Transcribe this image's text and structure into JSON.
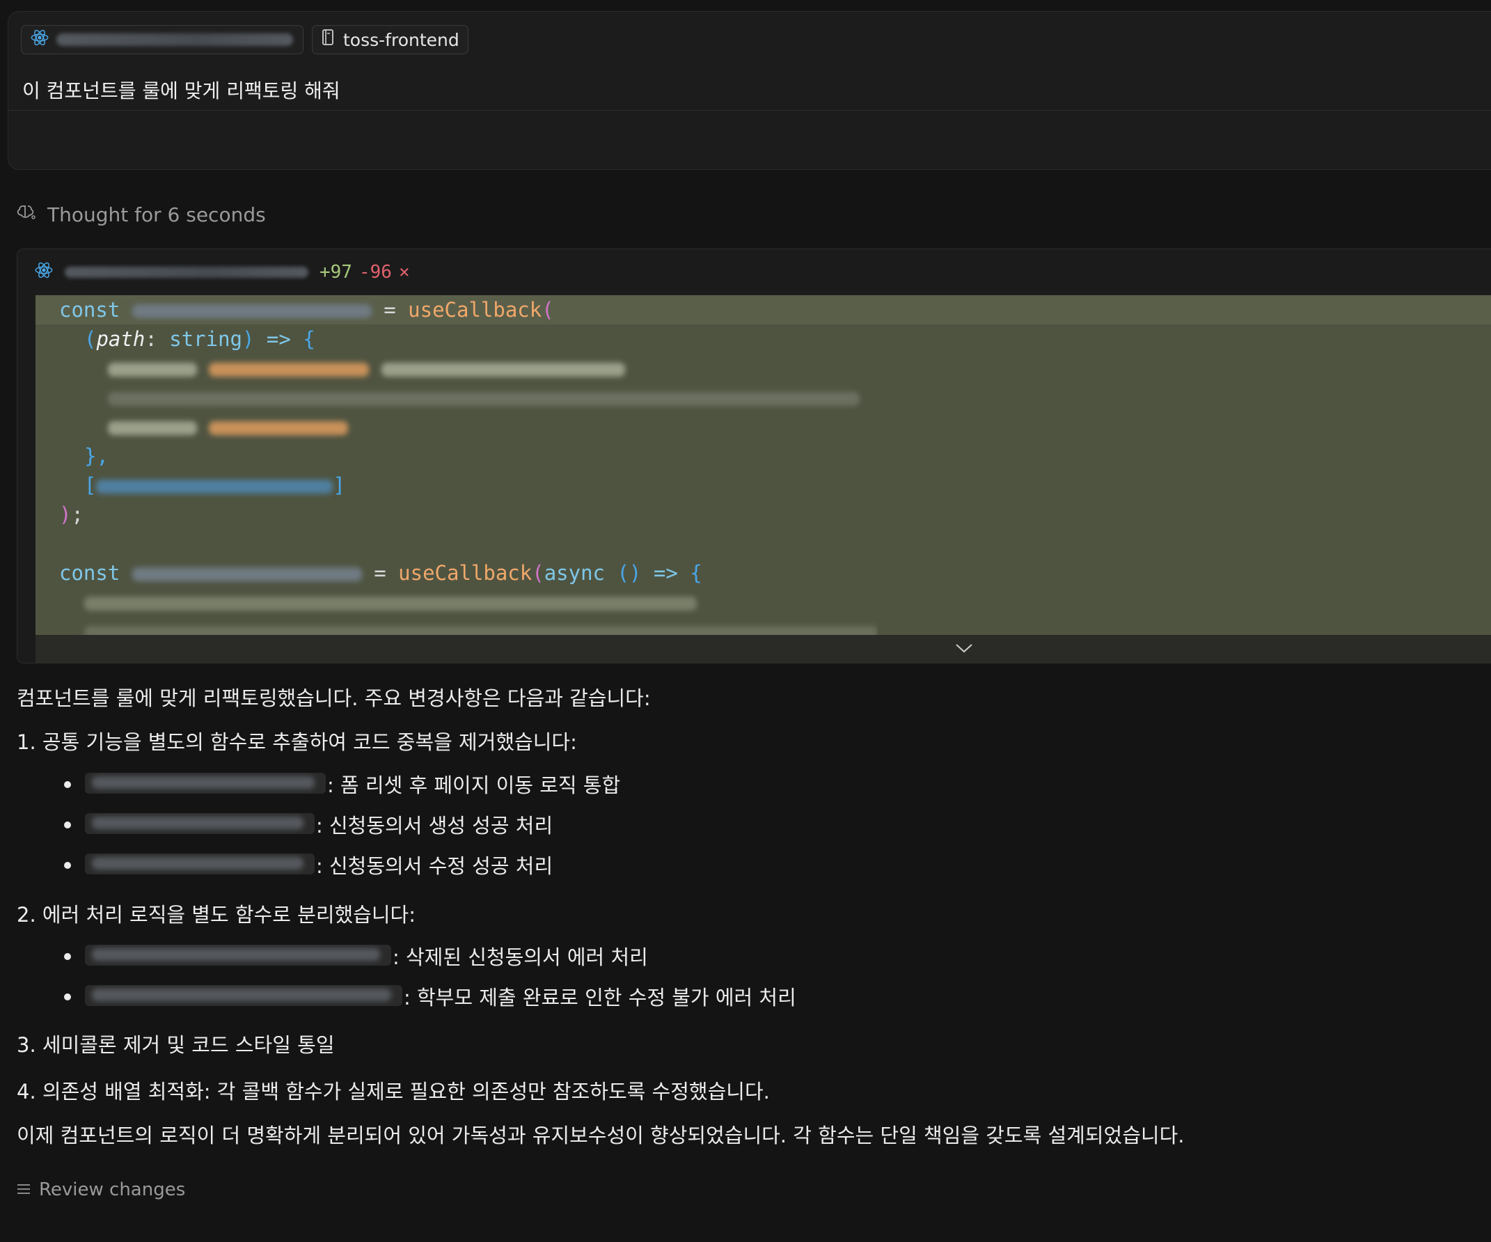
{
  "prompt": {
    "repo_chip_label": "toss-frontend",
    "text": "이 컴포넌트를 룰에 맞게 리팩토링 해줘"
  },
  "thought": {
    "label": "Thought for 6 seconds"
  },
  "diff": {
    "additions": "+97",
    "deletions": "-96",
    "close_glyph": "×",
    "code": {
      "l1_const": "const",
      "l1_eq": " = ",
      "l1_fn": "useCallback",
      "l1_open": "(",
      "l2_open": "(",
      "l2_param": "path",
      "l2_colon": ": ",
      "l2_type": "string",
      "l2_close": ")",
      "l2_arrow": " => ",
      "l2_brace": "{",
      "l6_close": "},",
      "l7_open": "[",
      "l7_close": "]",
      "l8_close": ")",
      "l8_semi": ";",
      "l10_const": "const",
      "l10_eq": " = ",
      "l10_fn": "useCallback",
      "l10_open": "(",
      "l10_async": "async",
      "l10_parens": " ()",
      "l10_arrow": " => ",
      "l10_brace": "{"
    }
  },
  "response": {
    "intro": "컴포넌트를 룰에 맞게 리팩토링했습니다. 주요 변경사항은 다음과 같습니다:",
    "item1": "1. 공통 기능을 별도의 함수로 추출하여 코드 중복을 제거했습니다:",
    "item1_b1": ": 폼 리셋 후 페이지 이동 로직 통합",
    "item1_b2": ": 신청동의서 생성 성공 처리",
    "item1_b3": ": 신청동의서 수정 성공 처리",
    "item2": "2. 에러 처리 로직을 별도 함수로 분리했습니다:",
    "item2_b1": ": 삭제된 신청동의서 에러 처리",
    "item2_b2": ": 학부모 제출 완료로 인한 수정 불가 에러 처리",
    "item3": "3. 세미콜론 제거 및 코드 스타일 통일",
    "item4": "4. 의존성 배열 최적화: 각 콜백 함수가 실제로 필요한 의존성만 참조하도록 수정했습니다.",
    "conclusion": "이제 컴포넌트의 로직이 더 명확하게 분리되어 있어 가독성과 유지보수성이 향상되었습니다. 각 함수는 단일 책임을 갖도록 설계되었습니다."
  },
  "review": {
    "label": "Review changes"
  },
  "colors": {
    "background": "#141414",
    "code_highlight": "#4f5441",
    "additions": "#a6c97a",
    "deletions": "#e0616b",
    "react_icon": "#4aa7e8"
  }
}
